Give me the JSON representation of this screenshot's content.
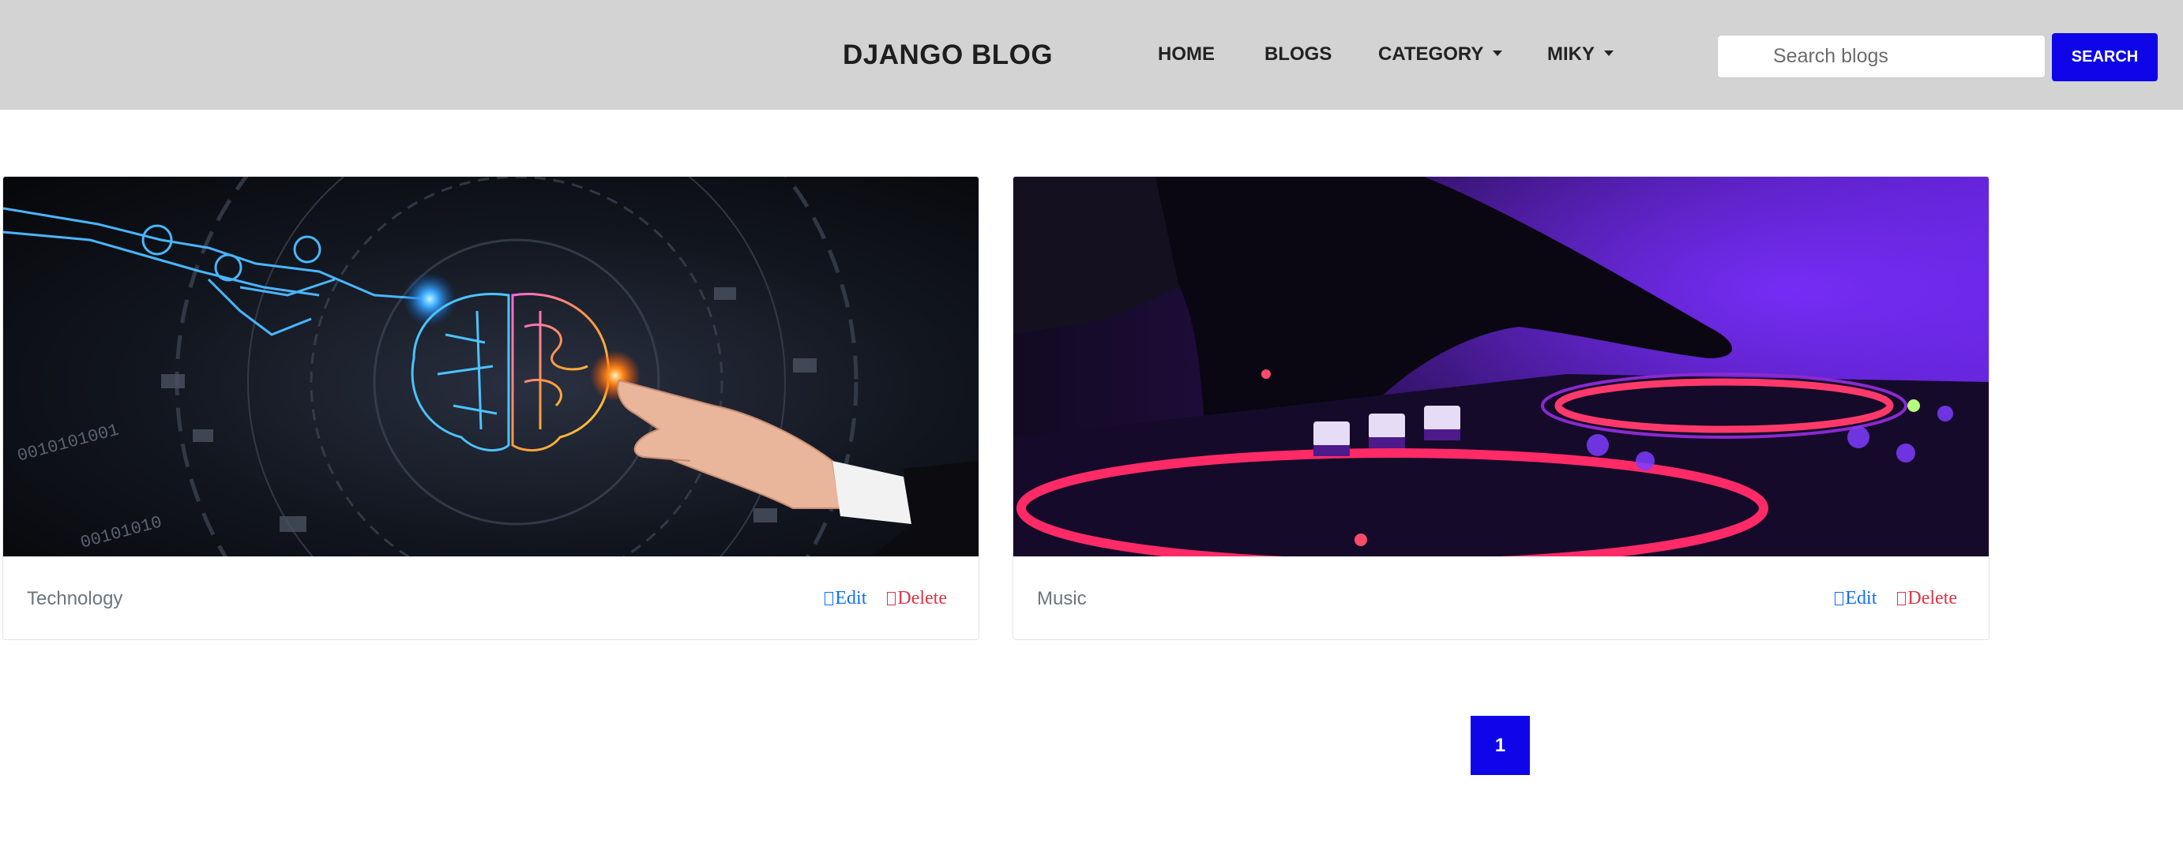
{
  "brand": "DJANGO BLOG",
  "nav": {
    "home": "HOME",
    "blogs": "BLOGS",
    "category": "CATEGORY",
    "user": "MIKY"
  },
  "search": {
    "placeholder": "Search blogs",
    "button_label": "SEARCH"
  },
  "posts": [
    {
      "category": "Technology",
      "image": "ai-brain-touch-image",
      "edit_label": "Edit",
      "delete_label": "Delete"
    },
    {
      "category": "Music",
      "image": "dj-mixer-image",
      "edit_label": "Edit",
      "delete_label": "Delete"
    }
  ],
  "pagination": {
    "current_page": "1"
  },
  "colors": {
    "navbar_bg": "#d3d3d3",
    "primary_button": "#0e06e8",
    "edit_link": "#0d6efd",
    "delete_link": "#dc3545"
  }
}
